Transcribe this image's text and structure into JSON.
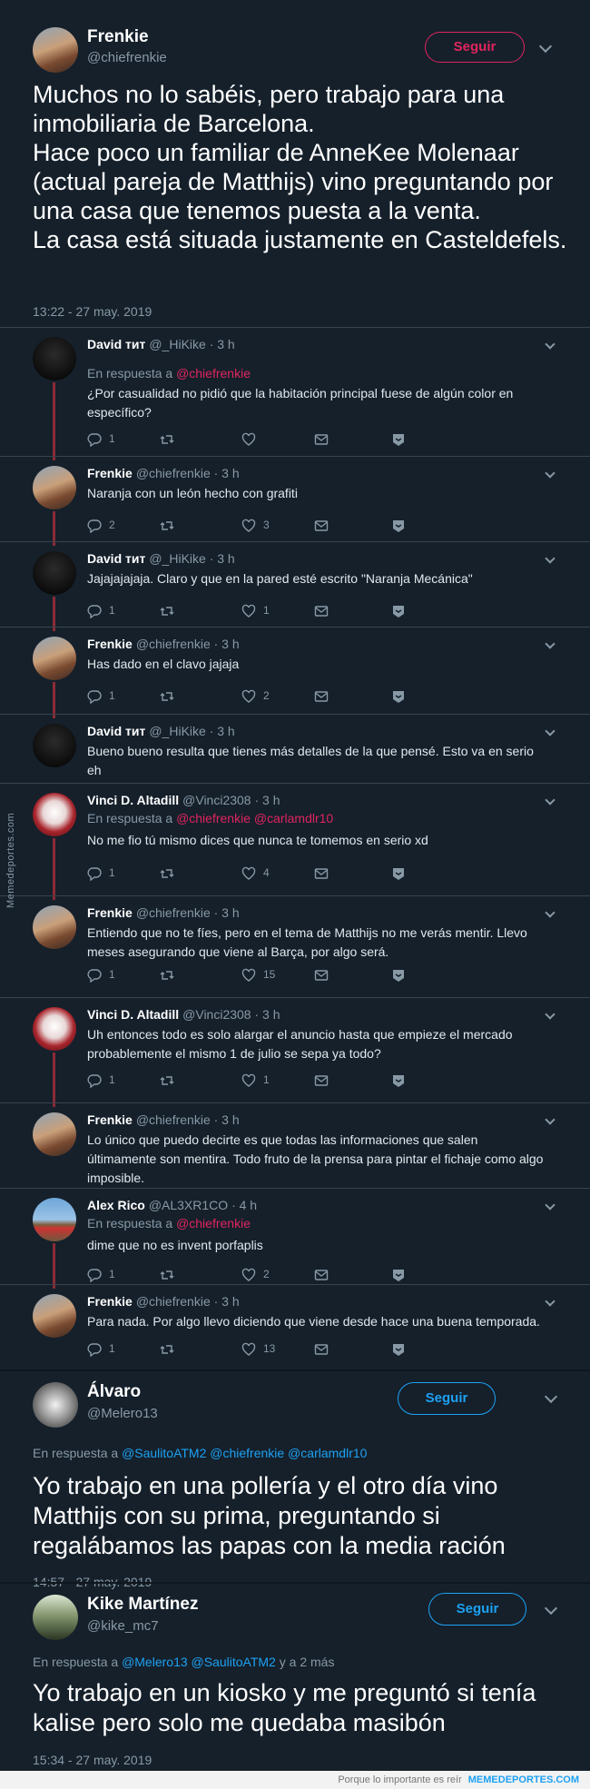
{
  "main": {
    "name": "Frenkie",
    "handle": "@chiefrenkie",
    "follow": "Seguir",
    "text": "Muchos no lo sabéis, pero trabajo para una inmobiliaria de Barcelona.\nHace poco un familiar de AnneKee Molenaar (actual pareja de Matthijs) vino preguntando por una casa que tenemos puesta a la venta.\nLa casa está situada justamente en Casteldefels.",
    "time": "13:22 - 27 may. 2019"
  },
  "colors": {
    "accent": "#1da1f2",
    "red": "#e0245e",
    "bg": "#15202b"
  },
  "replies": [
    {
      "name": "David ᴛᴎᴛ",
      "handle": "@_HiKike",
      "ago": "· 3 h",
      "reto_label": "En respuesta a",
      "reto": "@chiefrenkie",
      "text": "¿Por casualidad no pidió que la habitación principal fuese de algún color en específico?",
      "replies": "1",
      "retweets": "",
      "likes": ""
    },
    {
      "name": "Frenkie",
      "handle": "@chiefrenkie",
      "ago": "· 3 h",
      "text": "Naranja con un león hecho con grafiti",
      "replies": "2",
      "retweets": "",
      "likes": "3"
    },
    {
      "name": "David ᴛᴎᴛ",
      "handle": "@_HiKike",
      "ago": "· 3 h",
      "text": "Jajajajajaja. Claro y que en la pared esté escrito \"Naranja Mecánica\"",
      "replies": "1",
      "retweets": "",
      "likes": "1"
    },
    {
      "name": "Frenkie",
      "handle": "@chiefrenkie",
      "ago": "· 3 h",
      "text": "Has dado en el clavo jajaja",
      "replies": "1",
      "retweets": "",
      "likes": "2"
    },
    {
      "name": "David ᴛᴎᴛ",
      "handle": "@_HiKike",
      "ago": "· 3 h",
      "text": "Bueno bueno resulta que tienes más detalles de la que pensé. Esto va en serio eh"
    },
    {
      "name": "Vinci D. Altadill",
      "handle": "@Vinci2308",
      "ago": "· 3 h",
      "reto_label": "En respuesta a",
      "reto": "@chiefrenkie @carlamdlr10",
      "text": "No me fio tú mismo dices que nunca te tomemos en serio xd",
      "replies": "1",
      "retweets": "",
      "likes": "4"
    },
    {
      "name": "Frenkie",
      "handle": "@chiefrenkie",
      "ago": "· 3 h",
      "text": "Entiendo que no te fíes, pero en el tema de Matthijs no me verás mentir. Llevo meses asegurando que viene al Barça, por algo será.",
      "replies": "1",
      "retweets": "",
      "likes": "15"
    },
    {
      "name": "Vinci D. Altadill",
      "handle": "@Vinci2308",
      "ago": "· 3 h",
      "text": "Uh entonces todo es solo alargar el anuncio hasta que empieze el mercado probablemente el mismo 1 de julio se sepa ya todo?",
      "replies": "1",
      "retweets": "",
      "likes": "1"
    },
    {
      "name": "Frenkie",
      "handle": "@chiefrenkie",
      "ago": "· 3 h",
      "text": "Lo único que puedo decirte es que todas las informaciones que salen últimamente son mentira. Todo fruto de la prensa para pintar el fichaje como algo imposible."
    },
    {
      "name": "Alex Rico",
      "handle": "@AL3XR1CO",
      "ago": "· 4 h",
      "reto_label": "En respuesta a",
      "reto": "@chiefrenkie",
      "text": "dime que no es invent porfaplis",
      "replies": "1",
      "retweets": "",
      "likes": "2"
    },
    {
      "name": "Frenkie",
      "handle": "@chiefrenkie",
      "ago": "· 3 h",
      "text": "Para nada. Por algo llevo diciendo que viene desde hace una buena temporada.",
      "replies": "1",
      "retweets": "",
      "likes": "13"
    }
  ],
  "quote1": {
    "name": "Álvaro",
    "handle": "@Melero13",
    "follow": "Seguir",
    "reto_label": "En respuesta a",
    "reto": "@SaulitoATM2 @chiefrenkie @carlamdlr10",
    "text": "Yo trabajo en una pollería y el otro día vino Matthijs con su prima, preguntando si regalábamos las papas con la media ración",
    "time": "14:57 - 27 may. 2019"
  },
  "quote2": {
    "name": "Kike Martínez",
    "handle": "@kike_mc7",
    "follow": "Seguir",
    "reto_label": "En respuesta a",
    "reto": "@Melero13 @SaulitoATM2",
    "reto_more": "y a 2 más",
    "text": "Yo trabajo en un kiosko y me preguntó si tenía kalise pero solo me quedaba masibón",
    "time": "15:34 - 27 may. 2019"
  },
  "watermark": "Memedeportes.com",
  "footer": {
    "tagline": "Porque lo importante es reír",
    "brand": "MEMEDEPORTES.COM"
  },
  "icons": [
    "reply-icon",
    "retweet-icon",
    "like-icon",
    "dm-icon",
    "bookmark-icon",
    "chevron-down-icon"
  ]
}
